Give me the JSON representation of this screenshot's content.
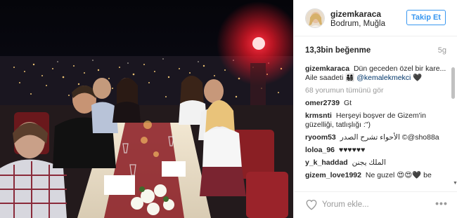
{
  "post": {
    "username": "gizemkaraca",
    "location": "Bodrum, Muğla",
    "follow_label": "Takip Et",
    "likes": "13,3bin beğenme",
    "time_ago": "5g"
  },
  "caption": {
    "user": "gizemkaraca",
    "text": "Dün geceden özel bir kare... Aile saadeti 👨‍👩‍👧‍👦",
    "mention": "@kemalekmekci",
    "suffix": " 🖤"
  },
  "view_more": "68 yorumun tümünü gör",
  "comments": [
    {
      "user": "omer2739",
      "text": "Gt"
    },
    {
      "user": "krmsnti",
      "text": "Herşeyi boşver de Gizem'in güzelliği, tatlışlığı :\")"
    },
    {
      "user": "ryoom53",
      "text": "الأحواء تشرح الصدر ©@sho88a"
    },
    {
      "user": "loloa_96",
      "text": "♥♥♥♥♥♥"
    },
    {
      "user": "y_k_haddad",
      "text": "الملك يجنن"
    },
    {
      "user": "gizem_love1992",
      "text": "Ne guzel 😍😍🖤 be"
    }
  ],
  "footer": {
    "placeholder": "Yorum ekle...",
    "more_label": "•••"
  },
  "colors": {
    "accent": "#3897f0",
    "muted": "#999999",
    "mention": "#003569",
    "neon_red": "#ff1a2a"
  },
  "icons": {
    "like": "heart-outline-icon",
    "more": "more-dots-icon"
  }
}
